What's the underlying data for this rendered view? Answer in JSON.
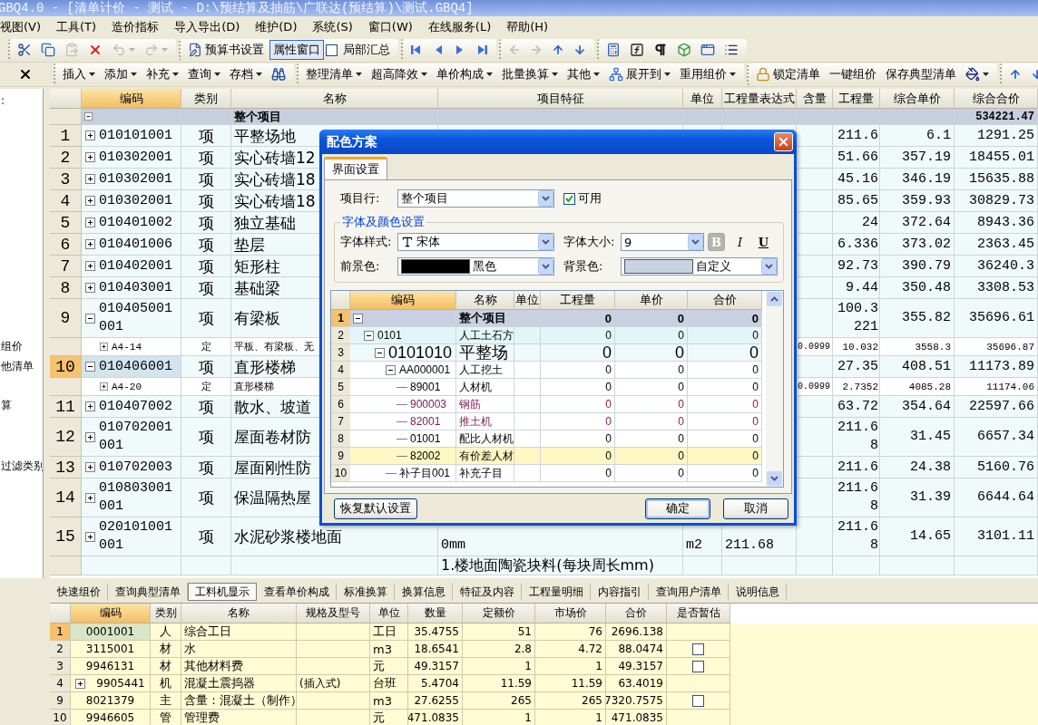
{
  "window": {
    "title": "GBQ4.0 - [清单计价 - 测试 - D:\\预结算及抽筋\\广联达(预结算)\\测试.GBQ4]"
  },
  "menu": [
    "视图(V)",
    "工具(T)",
    "造价指标",
    "导入导出(D)",
    "维护(D)",
    "系统(S)",
    "窗口(W)",
    "在线服务(L)",
    "帮助(H)"
  ],
  "toolbar": [
    [
      {
        "kind": "cut",
        "disabled": false
      },
      {
        "kind": "copy",
        "disabled": false
      },
      {
        "kind": "paste",
        "disabled": true
      },
      {
        "kind": "delete",
        "disabled": false
      },
      {
        "kind": "undo",
        "disabled": true
      },
      {
        "kind": "redo",
        "disabled": true
      }
    ],
    [
      {
        "kind": "settings",
        "label": "预算书设置",
        "disabled": false
      },
      {
        "kind": "toggle",
        "label": "属性窗口",
        "pressed": true,
        "disabled": false
      },
      {
        "kind": "checkbox",
        "label": "局部汇总",
        "checked": false,
        "disabled": false
      }
    ],
    [
      {
        "kind": "first",
        "disabled": false
      },
      {
        "kind": "prev",
        "disabled": false
      },
      {
        "kind": "next",
        "disabled": false
      },
      {
        "kind": "last",
        "disabled": false
      }
    ],
    [
      {
        "kind": "left",
        "disabled": true
      },
      {
        "kind": "right",
        "disabled": true
      },
      {
        "kind": "up",
        "disabled": false
      },
      {
        "kind": "down",
        "disabled": false
      }
    ],
    [
      {
        "kind": "calculator",
        "disabled": false
      },
      {
        "kind": "formula",
        "disabled": false
      },
      {
        "kind": "pilcrow",
        "disabled": false
      },
      {
        "kind": "cube",
        "disabled": false
      },
      {
        "kind": "window",
        "disabled": false
      },
      {
        "kind": "list",
        "disabled": false
      }
    ]
  ],
  "toolbar2": [
    [
      {
        "kind": "menu",
        "label": "插入"
      },
      {
        "kind": "menu",
        "label": "添加"
      },
      {
        "kind": "menu",
        "label": "补充"
      },
      {
        "kind": "menu",
        "label": "查询"
      },
      {
        "kind": "menu",
        "label": "存档"
      },
      {
        "kind": "find"
      }
    ],
    [
      {
        "kind": "menu",
        "label": "整理清单"
      },
      {
        "kind": "menu",
        "label": "超高降效"
      },
      {
        "kind": "menu",
        "label": "单价构成"
      },
      {
        "kind": "menu",
        "label": "批量换算"
      },
      {
        "kind": "menu",
        "label": "其他"
      },
      {
        "kind": "expand",
        "label": "展开到"
      },
      {
        "kind": "menu",
        "label": "重用组价"
      }
    ],
    [
      {
        "kind": "lock",
        "label": "锁定清单"
      },
      {
        "kind": "button",
        "label": "一键组价"
      },
      {
        "kind": "button",
        "label": "保存典型清单"
      },
      {
        "kind": "paint"
      }
    ],
    [
      {
        "kind": "up"
      },
      {
        "kind": "down"
      }
    ]
  ],
  "left_pane": {
    "items": [
      ":",
      "组价",
      "他清单",
      "算",
      "过滤类别"
    ]
  },
  "main_grid": {
    "columns": [
      {
        "label": "编码",
        "highlighted": true
      },
      {
        "label": "类别",
        "highlighted": false
      },
      {
        "label": "名称",
        "highlighted": false
      },
      {
        "label": "项目特征",
        "highlighted": false
      },
      {
        "label": "单位",
        "highlighted": false
      },
      {
        "label": "工程量表达式",
        "highlighted": false
      },
      {
        "label": "含量",
        "highlighted": false
      },
      {
        "label": "工程量",
        "highlighted": false
      },
      {
        "label": "综合单价",
        "highlighted": false
      },
      {
        "label": "综合合价",
        "highlighted": false
      }
    ],
    "total_row": {
      "name": "整个项目",
      "total": "534221.47",
      "expanded": true
    },
    "rows": [
      {
        "kind": "item",
        "no": "1",
        "code": "010101001",
        "type": "项",
        "name": "平整场地",
        "expanded": false,
        "selected": false,
        "quantity": "211.6",
        "unit_price": "6.1",
        "total": "1291.25"
      },
      {
        "kind": "item",
        "no": "2",
        "code": "010302001",
        "type": "项",
        "name": "实心砖墙12",
        "expanded": false,
        "selected": false,
        "quantity": "51.66",
        "unit_price": "357.19",
        "total": "18455.01"
      },
      {
        "kind": "item",
        "no": "3",
        "code": "010302001",
        "type": "项",
        "name": "实心砖墙18",
        "expanded": false,
        "selected": false,
        "quantity": "45.16",
        "unit_price": "346.19",
        "total": "15635.88"
      },
      {
        "kind": "item",
        "no": "4",
        "code": "010302001",
        "type": "项",
        "name": "实心砖墙18",
        "expanded": false,
        "selected": false,
        "quantity": "85.65",
        "unit_price": "359.93",
        "total": "30829.73"
      },
      {
        "kind": "item",
        "no": "5",
        "code": "010401002",
        "type": "项",
        "name": "独立基础",
        "expanded": false,
        "selected": false,
        "quantity": "24",
        "unit_price": "372.64",
        "total": "8943.36"
      },
      {
        "kind": "item",
        "no": "6",
        "code": "010401006",
        "type": "项",
        "name": "垫层",
        "expanded": false,
        "selected": false,
        "quantity": "6.336",
        "unit_price": "373.02",
        "total": "2363.45"
      },
      {
        "kind": "item",
        "no": "7",
        "code": "010402001",
        "type": "项",
        "name": "矩形柱",
        "expanded": false,
        "selected": false,
        "quantity": "92.73",
        "unit_price": "390.79",
        "total": "36240.3"
      },
      {
        "kind": "item",
        "no": "8",
        "code": "010403001",
        "type": "项",
        "name": "基础梁",
        "expanded": false,
        "selected": false,
        "quantity": "9.44",
        "unit_price": "350.48",
        "total": "3308.53"
      },
      {
        "kind": "item",
        "no": "9",
        "code": "010405001001",
        "type": "项",
        "name": "有梁板",
        "expanded": true,
        "selected": false,
        "quantity": "100.3221",
        "unit_price": "355.82",
        "total": "35696.61"
      },
      {
        "kind": "quota",
        "code": "A4-14",
        "type": "定",
        "name": "平板、有梁板、无",
        "expanded": false,
        "content": "0.0999",
        "quantity": "10.032",
        "unit_price": "3558.3",
        "total": "35696.87"
      },
      {
        "kind": "item",
        "no": "10",
        "code": "010406001",
        "type": "项",
        "name": "直形楼梯",
        "expanded": true,
        "selected": true,
        "quantity": "27.35",
        "unit_price": "408.51",
        "total": "11173.89"
      },
      {
        "kind": "quota",
        "code": "A4-20",
        "type": "定",
        "name": "直形楼梯",
        "expanded": false,
        "content": "0.0999",
        "quantity": "2.7352",
        "unit_price": "4085.28",
        "total": "11174.06"
      },
      {
        "kind": "item",
        "no": "11",
        "code": "010407002",
        "type": "项",
        "name": "散水、坡道",
        "expanded": false,
        "selected": false,
        "quantity": "63.72",
        "unit_price": "354.64",
        "total": "22597.66"
      },
      {
        "kind": "item",
        "no": "12",
        "code": "010702001001",
        "type": "项",
        "name": "屋面卷材防",
        "expanded": false,
        "selected": false,
        "quantity": "211.68",
        "unit_price": "31.45",
        "total": "6657.34"
      },
      {
        "kind": "item",
        "no": "13",
        "code": "010702003",
        "type": "项",
        "name": "屋面刚性防",
        "expanded": false,
        "selected": false,
        "quantity": "211.6",
        "unit_price": "24.38",
        "total": "5160.76"
      },
      {
        "kind": "item",
        "no": "14",
        "code": "010803001001",
        "type": "项",
        "name": "保温隔热屋",
        "expanded": false,
        "selected": false,
        "quantity": "211.68",
        "unit_price": "31.39",
        "total": "6644.64"
      },
      {
        "kind": "item",
        "no": "15",
        "code": "020101001001",
        "type": "项",
        "name": "水泥砂浆楼地面",
        "expanded": false,
        "selected": false,
        "features": "0mm",
        "unit": "m2",
        "expression": "211.68",
        "quantity": "211.68",
        "unit_price": "14.65",
        "total": "3101.11"
      },
      {
        "kind": "note",
        "features": "1.楼地面陶瓷块料(每块周长mm)"
      }
    ]
  },
  "dialog": {
    "title": "配色方案",
    "tab": {
      "label": "界面设置",
      "selected": true
    },
    "row_type": {
      "label": "项目行:",
      "value": "整个项目"
    },
    "enabled": {
      "label": "可用",
      "checked": true
    },
    "group": "字体及颜色设置",
    "font_style": {
      "label": "字体样式:",
      "value": "宋体"
    },
    "font_size": {
      "label": "字体大小:",
      "value": "9"
    },
    "format_buttons": [
      {
        "kind": "bold",
        "label": "B",
        "disabled": true
      },
      {
        "kind": "italic",
        "label": "I",
        "disabled": false
      },
      {
        "kind": "underline",
        "label": "U",
        "disabled": false
      }
    ],
    "foreground": {
      "label": "前景色:",
      "value": "黑色",
      "color": "#000000"
    },
    "background": {
      "label": "背景色:",
      "value": "自定义",
      "color": "#c8d2e2"
    },
    "grid": {
      "columns": [
        "编码",
        "名称",
        "单位",
        "工程量",
        "单价",
        "合价"
      ],
      "rows": [
        {
          "no": "1",
          "kind": "project",
          "code": "",
          "name": "整个项目",
          "quantity": "0",
          "price": "0",
          "total": "0",
          "selected": true,
          "expanded": true,
          "children": [
            {
              "no": "2",
              "kind": "division",
              "code": "0101",
              "name": "人工土石方",
              "quantity": "0",
              "price": "0",
              "total": "0",
              "selected": false,
              "expanded": true,
              "children": [
                {
                  "no": "3",
                  "kind": "item",
                  "code": "0101010",
                  "name": "平整场",
                  "quantity": "0",
                  "price": "0",
                  "total": "0",
                  "selected": false,
                  "expanded": true,
                  "children": [
                    {
                      "no": "4",
                      "code": "AA000001",
                      "name": "人工挖土",
                      "quantity": "0",
                      "price": "0",
                      "total": "0",
                      "selected": false,
                      "expanded": true,
                      "children": [
                        {
                          "no": "5",
                          "code": "89001",
                          "name": "人材机",
                          "quantity": "0",
                          "price": "0",
                          "total": "0",
                          "selected": false
                        },
                        {
                          "no": "6",
                          "kind": "material",
                          "code": "900003",
                          "name": "钢筋",
                          "quantity": "0",
                          "price": "0",
                          "total": "0",
                          "selected": false
                        },
                        {
                          "no": "7",
                          "kind": "machine",
                          "code": "82001",
                          "name": "推土机",
                          "quantity": "0",
                          "price": "0",
                          "total": "0",
                          "selected": false
                        },
                        {
                          "no": "8",
                          "code": "01001",
                          "name": "配比人材机",
                          "quantity": "0",
                          "price": "0",
                          "total": "0",
                          "selected": false
                        },
                        {
                          "no": "9",
                          "kind": "price-diff",
                          "code": "82002",
                          "name": "有价差人材",
                          "quantity": "0",
                          "price": "0",
                          "total": "0",
                          "selected": false
                        }
                      ]
                    },
                    {
                      "no": "10",
                      "code": "补子目001",
                      "name": "补充子目",
                      "quantity": "0",
                      "price": "0",
                      "total": "0",
                      "selected": false
                    }
                  ]
                }
              ]
            }
          ]
        }
      ]
    },
    "buttons": [
      {
        "kind": "reset",
        "label": "恢复默认设置"
      },
      {
        "kind": "ok",
        "label": "确定"
      },
      {
        "kind": "cancel",
        "label": "取消"
      }
    ]
  },
  "detail_tabs": [
    {
      "label": "快速组价",
      "selected": false
    },
    {
      "label": "查询典型清单",
      "selected": false
    },
    {
      "label": "工料机显示",
      "selected": true
    },
    {
      "label": "查看单价构成",
      "selected": false
    },
    {
      "label": "标准换算",
      "selected": false
    },
    {
      "label": "换算信息",
      "selected": false
    },
    {
      "label": "特征及内容",
      "selected": false
    },
    {
      "label": "工程量明细",
      "selected": false
    },
    {
      "label": "内容指引",
      "selected": false
    },
    {
      "label": "查询用户清单",
      "selected": false
    },
    {
      "label": "说明信息",
      "selected": false
    }
  ],
  "resources": {
    "columns": [
      {
        "label": "编码",
        "highlighted": true
      },
      {
        "label": "类别",
        "highlighted": false
      },
      {
        "label": "名称",
        "highlighted": false
      },
      {
        "label": "规格及型号",
        "highlighted": false
      },
      {
        "label": "单位",
        "highlighted": false
      },
      {
        "label": "数量",
        "highlighted": false
      },
      {
        "label": "定额价",
        "highlighted": false
      },
      {
        "label": "市场价",
        "highlighted": false
      },
      {
        "label": "合价",
        "highlighted": false
      },
      {
        "label": "是否暂估",
        "highlighted": false
      }
    ],
    "rows": [
      {
        "no": "1",
        "code": "0001001",
        "type": "人",
        "name": "综合工日",
        "unit": "工日",
        "amount": "35.4755",
        "quota_price": "51",
        "market_price": "76",
        "total": "2696.138",
        "selected": true
      },
      {
        "no": "2",
        "code": "3115001",
        "type": "材",
        "name": "水",
        "unit": "m3",
        "amount": "18.6541",
        "quota_price": "2.8",
        "market_price": "4.72",
        "total": "88.0474",
        "selected": false,
        "estimated": false
      },
      {
        "no": "3",
        "code": "9946131",
        "type": "材",
        "name": "其他材料费",
        "unit": "元",
        "amount": "49.3157",
        "quota_price": "1",
        "market_price": "1",
        "total": "49.3157",
        "selected": false,
        "estimated": false
      },
      {
        "no": "4",
        "code": "9905441",
        "type": "机",
        "name": "混凝土震捣器",
        "spec": "(插入式)",
        "unit": "台班",
        "amount": "5.4704",
        "quota_price": "11.59",
        "market_price": "11.59",
        "total": "63.4019",
        "selected": false,
        "expanded": false
      },
      {
        "no": "9",
        "code": "8021379",
        "type": "主",
        "name": "含量：混凝土（制作）",
        "unit": "m3",
        "amount": "27.6255",
        "quota_price": "265",
        "market_price": "265",
        "total": "7320.7575",
        "selected": false,
        "estimated": false
      },
      {
        "no": "10",
        "code": "9946605",
        "type": "管",
        "name": "管理费",
        "unit": "元",
        "amount": "471.0835",
        "quota_price": "1",
        "market_price": "1",
        "total": "471.0835",
        "selected": false
      }
    ]
  }
}
